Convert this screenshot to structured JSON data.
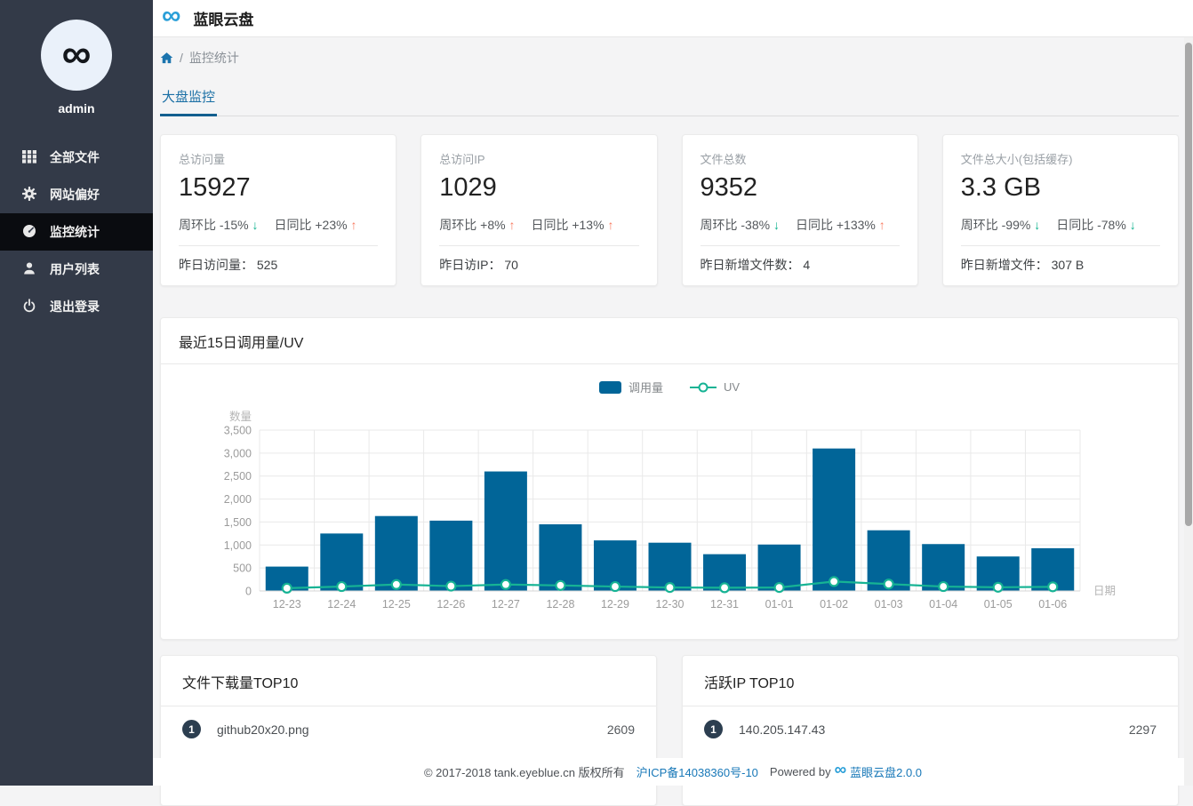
{
  "header": {
    "title": "蓝眼云盘",
    "logo_glyph": "∞"
  },
  "sidebar": {
    "username": "admin",
    "avatar_glyph": "∞",
    "items": [
      {
        "key": "all-files",
        "icon": "grid-icon",
        "label": "全部文件",
        "active": false
      },
      {
        "key": "site-pref",
        "icon": "gear-icon",
        "label": "网站偏好",
        "active": false
      },
      {
        "key": "monitor",
        "icon": "gauge-icon",
        "label": "监控统计",
        "active": true
      },
      {
        "key": "user-list",
        "icon": "user-icon",
        "label": "用户列表",
        "active": false
      },
      {
        "key": "logout",
        "icon": "power-icon",
        "label": "退出登录",
        "active": false
      }
    ]
  },
  "breadcrumb": {
    "separator": "/",
    "current": "监控统计"
  },
  "tab": {
    "label": "大盘监控"
  },
  "cards": [
    {
      "title": "总访问量",
      "value": "15927",
      "trends": [
        {
          "label": "周环比",
          "delta": "-15%",
          "dir": "down"
        },
        {
          "label": "日同比",
          "delta": "+23%",
          "dir": "up"
        }
      ],
      "footer_label": "昨日访问量：",
      "footer_value": "525"
    },
    {
      "title": "总访问IP",
      "value": "1029",
      "trends": [
        {
          "label": "周环比",
          "delta": "+8%",
          "dir": "up"
        },
        {
          "label": "日同比",
          "delta": "+13%",
          "dir": "up"
        }
      ],
      "footer_label": "昨日访IP：",
      "footer_value": "70"
    },
    {
      "title": "文件总数",
      "value": "9352",
      "trends": [
        {
          "label": "周环比",
          "delta": "-38%",
          "dir": "down"
        },
        {
          "label": "日同比",
          "delta": "+133%",
          "dir": "up"
        }
      ],
      "footer_label": "昨日新增文件数：",
      "footer_value": "4"
    },
    {
      "title": "文件总大小(包括缓存)",
      "value": "3.3 GB",
      "trends": [
        {
          "label": "周环比",
          "delta": "-99%",
          "dir": "down"
        },
        {
          "label": "日同比",
          "delta": "-78%",
          "dir": "down"
        }
      ],
      "footer_label": "昨日新增文件：",
      "footer_value": "307 B"
    }
  ],
  "chart_panel": {
    "title": "最近15日调用量/UV"
  },
  "chart_data": {
    "type": "bar+line",
    "categories": [
      "12-23",
      "12-24",
      "12-25",
      "12-26",
      "12-27",
      "12-28",
      "12-29",
      "12-30",
      "12-31",
      "01-01",
      "01-02",
      "01-03",
      "01-04",
      "01-05",
      "01-06"
    ],
    "series": [
      {
        "name": "调用量",
        "type": "bar",
        "color": "#016598",
        "values": [
          530,
          1250,
          1630,
          1530,
          2600,
          1450,
          1100,
          1050,
          800,
          1010,
          3100,
          1320,
          1020,
          750,
          930
        ]
      },
      {
        "name": "UV",
        "type": "line",
        "color": "#16b394",
        "values": [
          60,
          95,
          140,
          105,
          140,
          120,
          95,
          75,
          70,
          75,
          205,
          150,
          95,
          80,
          90
        ]
      }
    ],
    "xlabel": "日期",
    "ylabel": "数量",
    "ylim": [
      0,
      3500
    ],
    "ytick_step": 500,
    "grid": true,
    "legend_position": "top-center"
  },
  "top_lists": [
    {
      "title": "文件下载量TOP10",
      "rows": [
        {
          "rank": "1",
          "name": "github20x20.png",
          "value": "2609"
        }
      ]
    },
    {
      "title": "活跃IP TOP10",
      "rows": [
        {
          "rank": "1",
          "name": "140.205.147.43",
          "value": "2297"
        }
      ]
    }
  ],
  "footer": {
    "copyright": "© 2017-2018 tank.eyeblue.cn 版权所有",
    "icp_link": "沪ICP备14038360号-10",
    "powered_by": "Powered by",
    "product_link": "蓝眼云盘2.0.0",
    "logo_glyph": "∞"
  },
  "colors": {
    "accent_blue": "#1a6fa5",
    "bar": "#016598",
    "line": "#16b394",
    "up_arrow": "#f97b60",
    "down_arrow": "#0cb18c",
    "sidebar_bg": "#333a48",
    "sidebar_active_bg": "#0a0c10",
    "badge": "#2c3e50"
  }
}
